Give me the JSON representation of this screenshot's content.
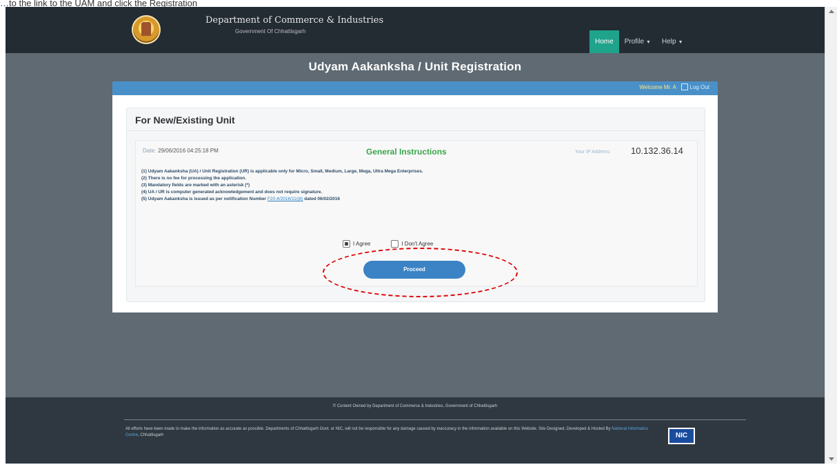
{
  "caption": "…to the link to the UAM and click the Registration",
  "header": {
    "department": "Department of Commerce & Industries",
    "government": "Government Of Chhattisgarh",
    "nav": [
      {
        "label": "Home",
        "active": true,
        "caret": false
      },
      {
        "label": "Profile",
        "active": false,
        "caret": true
      },
      {
        "label": "Help",
        "active": false,
        "caret": true
      }
    ]
  },
  "page_title": "Udyam Aakanksha / Unit Registration",
  "user_bar": {
    "welcome": "Welcome Mr. A",
    "logout": "Log Out"
  },
  "section": {
    "title": "For New/Existing Unit",
    "date_label": "Date:",
    "date_value": "29/06/2016 04:25:18 PM",
    "instructions_title": "General Instructions",
    "ip_label": "Your IP Address:",
    "ip_value": "10.132.36.14",
    "instructions": [
      "(1) Udyam Aakanksha (UA) / Unit Registration (UR) is applicable only for Micro, Small, Medium, Large, Mega, Ultra Mega Enterprises.",
      "(2) There is no fee for processing the application.",
      "(3) Mandatory fields are marked with an asterisk (*)",
      "(4) UA / UR is computer generated acknowledgement and does not require signature."
    ],
    "instruction_5_prefix": "(5) Udyam Aakanksha is issued as per notification Number",
    "notification_number": "F20-4/2016/11/(8)",
    "instruction_5_suffix": "dated 06/02/2016",
    "agree_label": "I Agree",
    "disagree_label": "I Don't Agree",
    "proceed_label": "Proceed"
  },
  "footer": {
    "copyright": "© Content Owned by Department of Commerce & Industries, Government of Chhattisgarh",
    "disclaimer_start": "All efforts have been made to make the information as accurate as possible. Departments of Chhattisgarh Govt. or NIC, will not be responsible for any damage caused by inaccuracy in the information available on this Website. Site Designed, Developed & Hosted By",
    "nic_link": "National Informatics Centre",
    "disclaimer_end": ", Chhattisgarh",
    "nic_logo": "NIC"
  },
  "colors": {
    "header_bg": "#232b33",
    "page_bg": "#5f6a73",
    "nav_active": "#1fa38a",
    "user_bar": "#4a90c8",
    "proceed_button": "#3b83c4",
    "instructions_heading": "#3aa64a",
    "highlight": "#e00000"
  },
  "icons": {
    "logo": "state-emblem",
    "logout": "logout-icon",
    "dropdown": "chevron-down-icon"
  }
}
